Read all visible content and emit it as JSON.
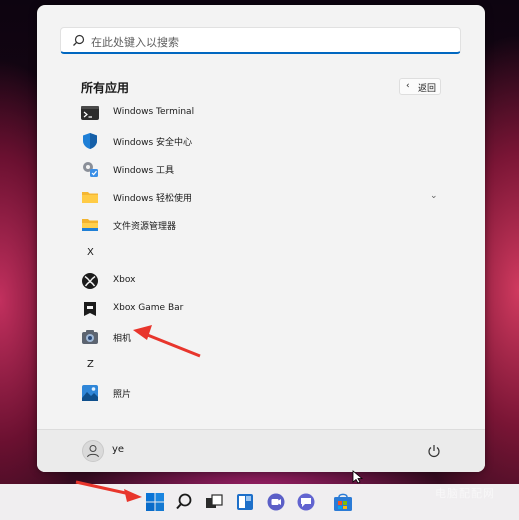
{
  "search": {
    "placeholder": "在此处键入以搜索"
  },
  "all_apps": {
    "title": "所有应用",
    "back_label": "返回",
    "items": [
      {
        "type": "app",
        "label": "Windows Terminal",
        "icon": "terminal-icon"
      },
      {
        "type": "app",
        "label": "Windows 安全中心",
        "icon": "shield-icon"
      },
      {
        "type": "app",
        "label": "Windows 工具",
        "icon": "tools-gear-icon"
      },
      {
        "type": "folder",
        "label": "Windows 轻松使用",
        "icon": "folder-icon",
        "expandable": true
      },
      {
        "type": "app",
        "label": "文件资源管理器",
        "icon": "file-explorer-icon"
      },
      {
        "type": "letter",
        "label": "X"
      },
      {
        "type": "app",
        "label": "Xbox",
        "icon": "xbox-icon"
      },
      {
        "type": "app",
        "label": "Xbox Game Bar",
        "icon": "xbox-game-bar-icon"
      },
      {
        "type": "app",
        "label": "相机",
        "icon": "camera-icon"
      },
      {
        "type": "letter",
        "label": "Z"
      },
      {
        "type": "app",
        "label": "照片",
        "icon": "photos-icon"
      }
    ]
  },
  "footer": {
    "user_name": "ye"
  },
  "taskbar": {
    "icons": [
      "windows-start-icon",
      "search-icon",
      "task-view-icon",
      "widgets-icon",
      "chat-icon",
      "chat-icon-2",
      "store-icon"
    ]
  },
  "watermark": {
    "text": "电脑配配网"
  },
  "colors": {
    "accent": "#0067c0",
    "annotation_arrow": "#e8352c"
  }
}
